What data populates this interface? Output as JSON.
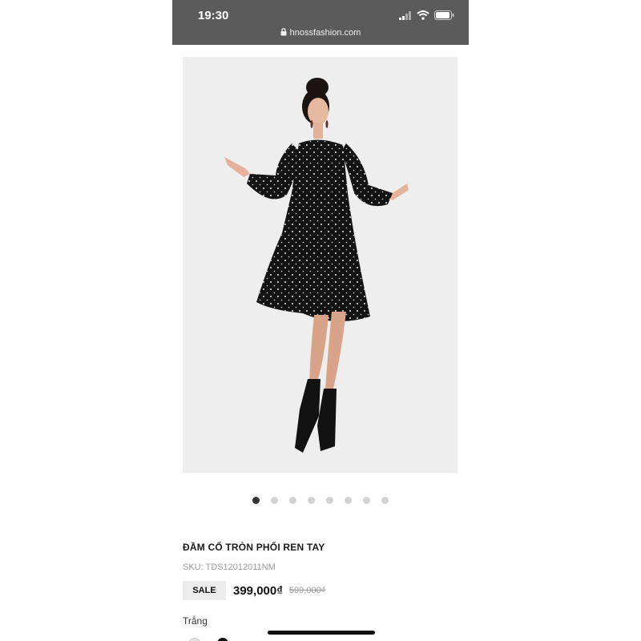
{
  "status_bar": {
    "time": "19:30"
  },
  "browser": {
    "url": "hnossfashion.com"
  },
  "product": {
    "image_alt": "Model wearing black polka dot dress",
    "carousel": {
      "total": 8,
      "active": 1
    },
    "title": "ĐẦM CỔ TRÒN PHỐI REN TAY",
    "sku": "SKU: TDS12012011NM",
    "sale_label": "SALE",
    "price_current": "399,000₫",
    "price_old": "599,000₫",
    "color_label": "Trắng"
  },
  "colors": {
    "browser_bar": "#5b5b5b",
    "dress": "#141414",
    "image_bg": "#eeeeee"
  }
}
